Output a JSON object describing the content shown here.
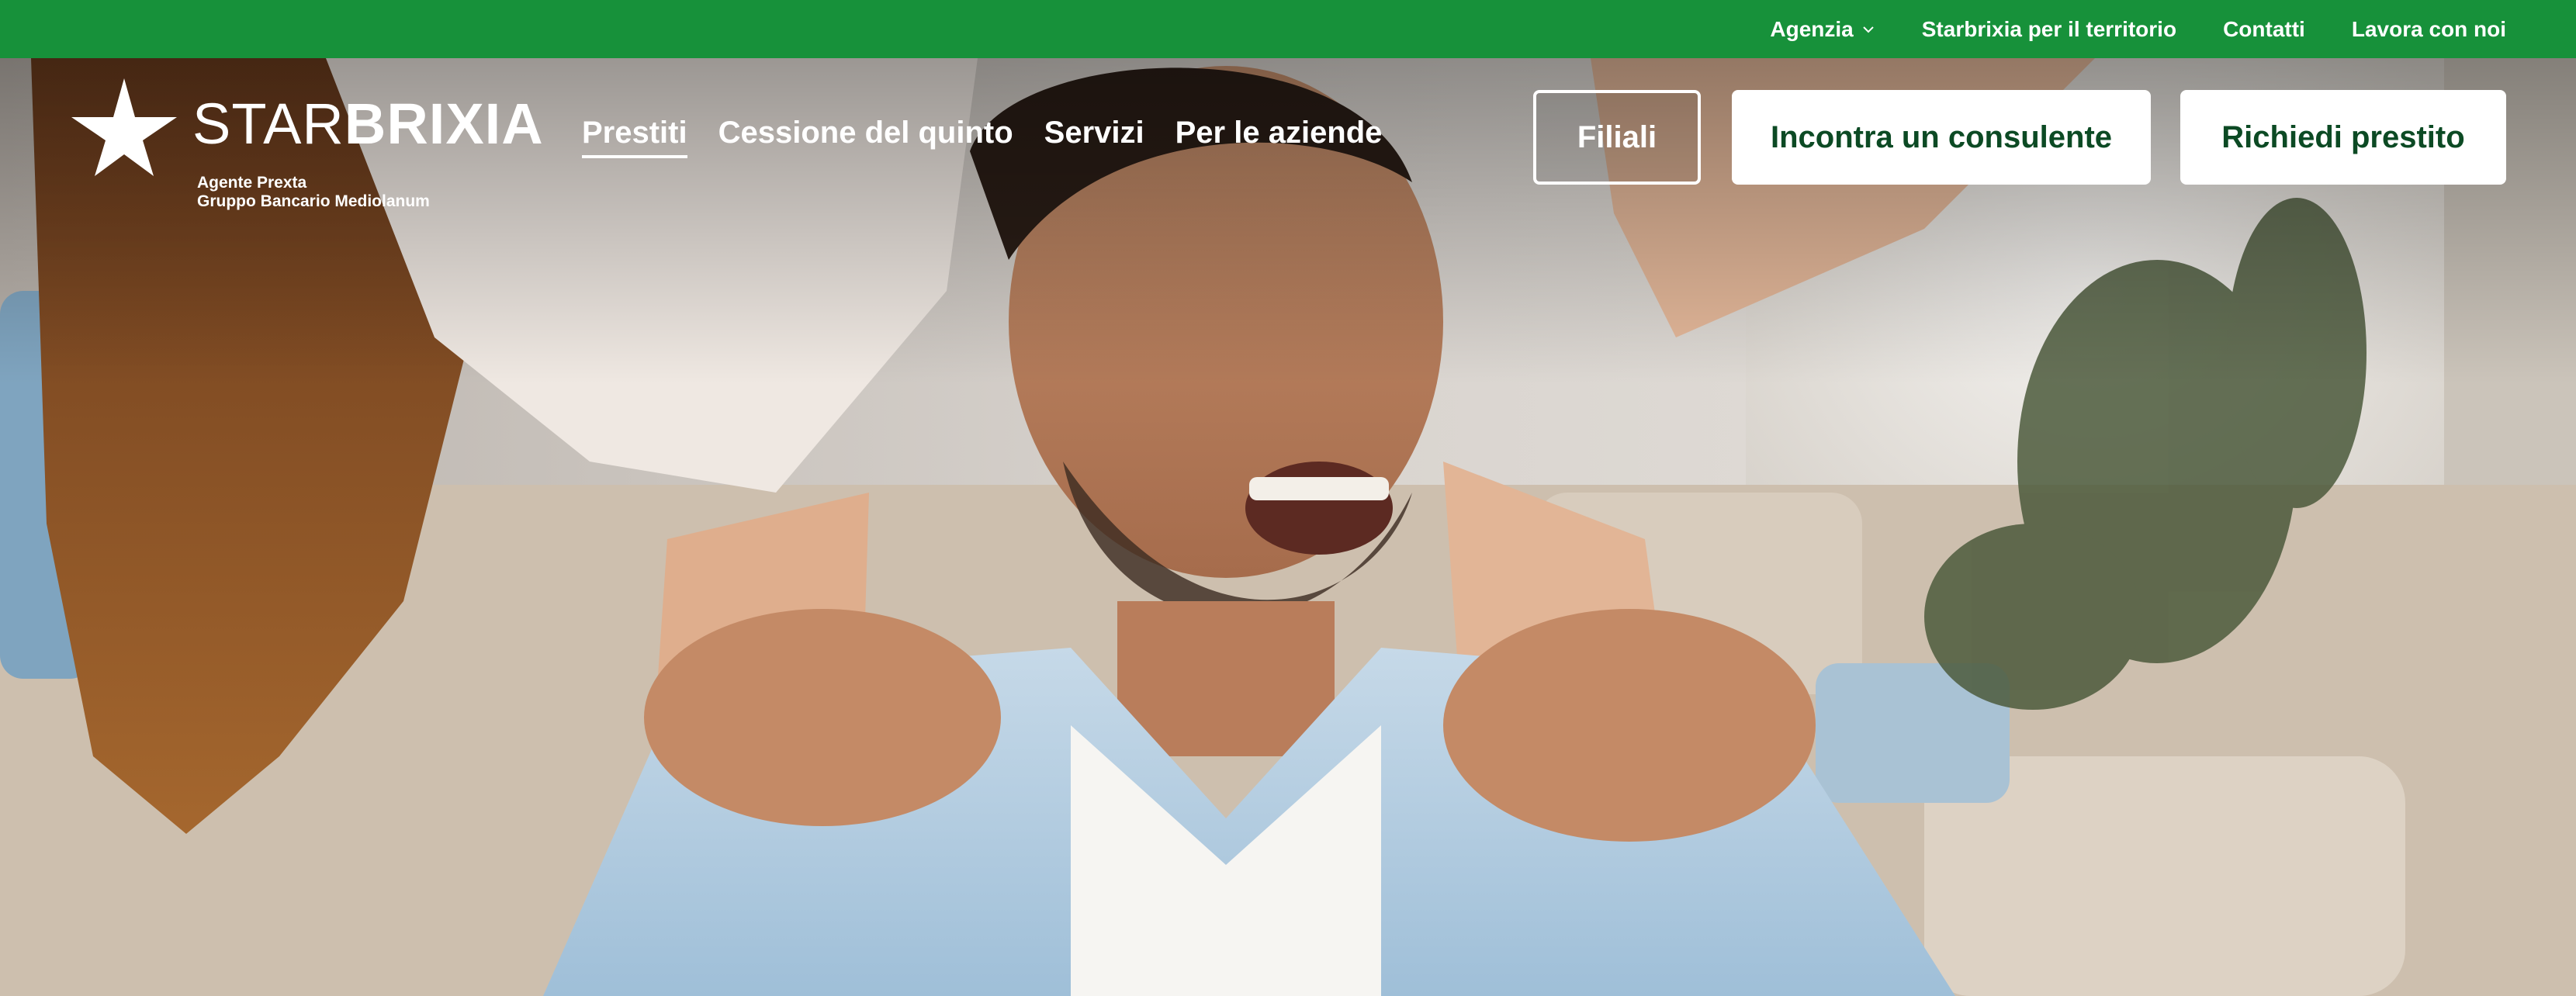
{
  "topbar": {
    "items": [
      {
        "label": "Agenzia",
        "has_dropdown": true
      },
      {
        "label": "Starbrixia per il territorio"
      },
      {
        "label": "Contatti"
      },
      {
        "label": "Lavora con noi"
      }
    ]
  },
  "logo": {
    "word_light": "STAR",
    "word_bold": "BRIXIA",
    "sub_line1": "Agente Prexta",
    "sub_line2": "Gruppo Bancario Mediolanum",
    "icon": "star-icon"
  },
  "mainnav": {
    "items": [
      {
        "label": "Prestiti",
        "active": true
      },
      {
        "label": "Cessione del quinto"
      },
      {
        "label": "Servizi"
      },
      {
        "label": "Per le aziende"
      }
    ]
  },
  "actions": {
    "branches": "Filiali",
    "consultant": "Incontra un consulente",
    "request": "Richiedi prestito"
  },
  "colors": {
    "brand_green": "#17913a",
    "button_text_green": "#0c4a24"
  }
}
